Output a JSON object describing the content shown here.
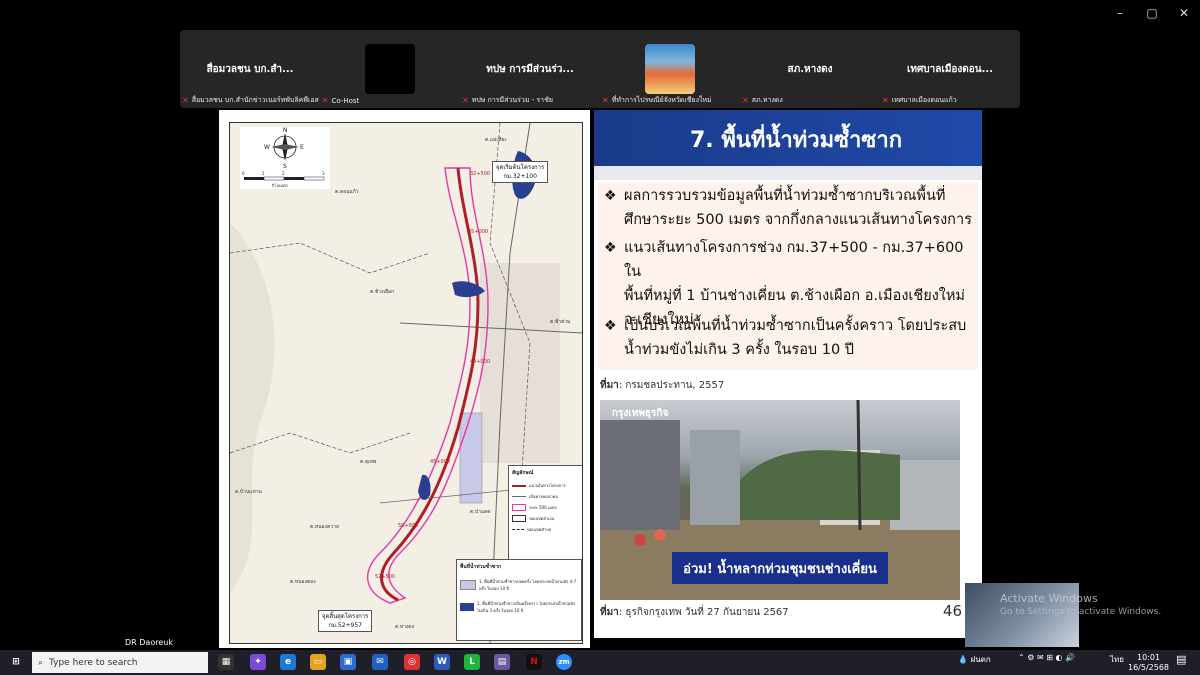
{
  "window": {
    "controls": [
      "–",
      "▢",
      "✕"
    ]
  },
  "participants": [
    {
      "name": "สื่อมวลชน บก.สำ...",
      "footer": "สื่อมวลชน บก.สำนักข่าวเนอร์ทพับลิคพีเอส",
      "footer2": "Co-Host"
    },
    {
      "name": "",
      "footer": ""
    },
    {
      "name": "ทปษ การมีส่วนร่ว...",
      "footer": "ทปษ การมีส่วนร่วม - ราชัย"
    },
    {
      "name": "",
      "footer": "ที่ทำการไปรษณีย์จังหวัดเชียงใหม่"
    },
    {
      "name": "สภ.หางดง",
      "footer": "สภ.หางดง"
    },
    {
      "name": "เทศบาลเมืองดอน...",
      "footer": "เทศบาลเมืองดอนแก้ว"
    }
  ],
  "map": {
    "scale_labels": [
      "0",
      "1",
      "2",
      "3"
    ],
    "scale_unit": "กิโลเมตร",
    "compass": [
      "N",
      "S",
      "E",
      "W"
    ],
    "start_label": "จุดเริ่มต้นโครงการ",
    "start_km": "กม.32+100",
    "end_label": "จุดสิ้นสุดโครงการ",
    "end_km": "กม.52+957",
    "legend_title": "สัญลักษณ์",
    "legend_items": [
      "แนวเส้นทางโครงการ",
      "เส้นทางคมนาคม",
      "ระยะ 500 เมตร",
      "ขอบเขตอำเภอ",
      "ขอบเขตตำบล"
    ],
    "legend2_title": "พื้นที่น้ำท่วมซ้ำซาก",
    "legend2_items": [
      "1. พื้นที่น้ำท่วมซ้ำซากบ่อยครั้ง โดยประสบน้ำท่วมขัง 4-7 ครั้ง ในรอบ 10 ปี",
      "2. พื้นที่น้ำท่วมซ้ำซากเป็นครั้งคราว โดยประสบน้ำท่วมขังไม่เกิน 3 ครั้ง ในรอบ 10 ปี"
    ],
    "place_labels": [
      "ต.แม่เหียะ",
      "ต.ดอนแก้ว",
      "ต.ช้างเผือก",
      "ต.สุเทพ",
      "ต.ฟ้าฮ่าม",
      "ต.ป่าแดด",
      "ต.หนองควาย",
      "ต.บ้านแหวน",
      "ต.หางดง",
      "ต.หนองตอง"
    ],
    "km_marks": [
      "32+500",
      "35+000",
      "40+000",
      "45+000",
      "50+000",
      "52+500"
    ]
  },
  "slide": {
    "title": "7. พื้นที่น้ำท่วมซ้ำซาก",
    "bullets": [
      "ผลการรวบรวมข้อมูลพื้นที่น้ำท่วมซ้ำซากบริเวณพื้นที่\nศึกษาระยะ 500 เมตร จากกึ่งกลางแนวเส้นทางโครงการ",
      "แนวเส้นทางโครงการช่วง กม.37+500 - กม.37+600 ใน\nพื้นที่หมู่ที่ 1 บ้านช่างเคี่ยน ต.ช้างเผือก อ.เมืองเชียงใหม่\nจ.เชียงใหม่",
      "เป็นบริเวณพื้นที่น้ำท่วมซ้ำซากเป็นครั้งคราว โดยประสบ\nน้ำท่วมขังไม่เกิน 3 ครั้ง ในรอบ 10 ปี"
    ],
    "source1_label": "ที่มา",
    "source1": ": กรมชลประทาน, 2557",
    "photo_brand": "กรุงเทพธุรกิจ",
    "photo_caption": "อ่วม! น้ำหลากท่วมชุมชนช่างเคี่ยน",
    "source2_label": "ที่มา",
    "source2": ": ธุรกิจกรุงเทพ วันที่ 27 กันยายน 2567",
    "page_number": "46"
  },
  "self_view": {
    "activate_title": "Activate Windows",
    "activate_sub": "Go to Settings to activate Windows."
  },
  "username": "DR Daoreuk",
  "taskbar": {
    "search_placeholder": "Type here to search",
    "weather": "ฝนตก",
    "lang": "ไทย",
    "time": "10:01",
    "date": "16/5/2568",
    "mail_badge": "7"
  },
  "colors": {
    "slide_title_bg": "#1f4aa8",
    "route": "#b01d2a",
    "buffer": "#e03aa8",
    "flood": "#2a3f8f"
  }
}
